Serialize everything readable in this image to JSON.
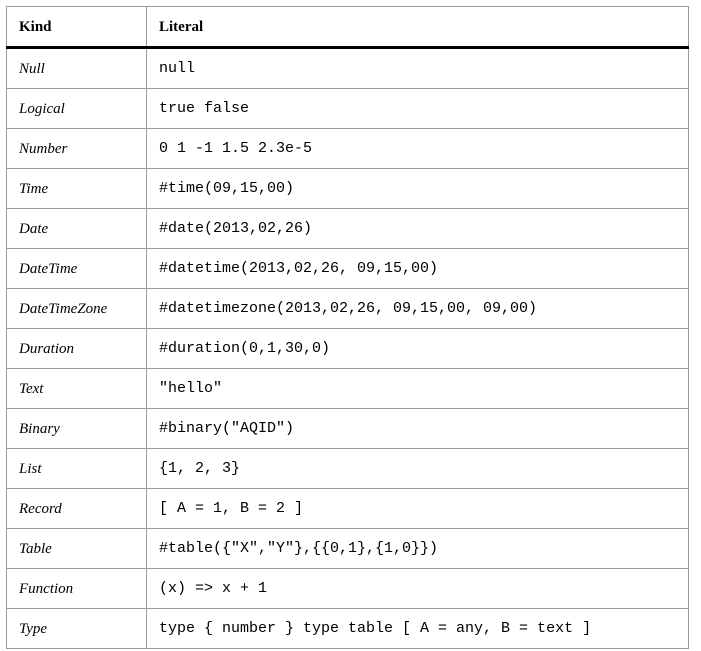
{
  "table": {
    "headers": {
      "kind": "Kind",
      "literal": "Literal"
    },
    "rows": [
      {
        "kind": "Null",
        "literal": "null"
      },
      {
        "kind": "Logical",
        "literal": "true   false"
      },
      {
        "kind": "Number",
        "literal": "0   1   -1   1.5   2.3e-5"
      },
      {
        "kind": "Time",
        "literal": "#time(09,15,00)"
      },
      {
        "kind": "Date",
        "literal": "#date(2013,02,26)"
      },
      {
        "kind": "DateTime",
        "literal": "#datetime(2013,02,26, 09,15,00)"
      },
      {
        "kind": "DateTimeZone",
        "literal": "#datetimezone(2013,02,26, 09,15,00, 09,00)"
      },
      {
        "kind": "Duration",
        "literal": "#duration(0,1,30,0)"
      },
      {
        "kind": "Text",
        "literal": "\"hello\""
      },
      {
        "kind": "Binary",
        "literal": "#binary(\"AQID\")"
      },
      {
        "kind": "List",
        "literal": "{1, 2, 3}"
      },
      {
        "kind": "Record",
        "literal": "[ A = 1, B = 2 ]"
      },
      {
        "kind": "Table",
        "literal": "#table({\"X\",\"Y\"},{{0,1},{1,0}})"
      },
      {
        "kind": "Function",
        "literal": "(x) => x + 1"
      },
      {
        "kind": "Type",
        "literal": "type { number }   type table [ A = any, B = text ]"
      }
    ]
  }
}
